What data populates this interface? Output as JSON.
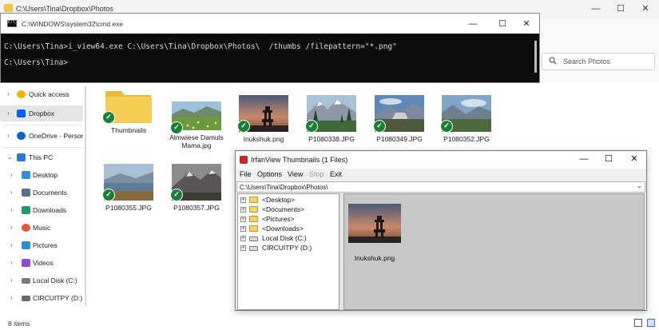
{
  "explorer": {
    "title": "C:\\Users\\Tina\\Dropbox\\Photos",
    "search_placeholder": "Search Photos",
    "status": "8 items",
    "sidebar": [
      {
        "label": "Quick access",
        "icon": "star-icon",
        "color": "#f5b400"
      },
      {
        "label": "Dropbox",
        "icon": "dropbox-icon",
        "color": "#0061fe"
      },
      {
        "label": "OneDrive - Person",
        "icon": "cloud-icon",
        "color": "#0a64c8"
      },
      {
        "label": "This PC",
        "icon": "pc-icon",
        "color": "#2b7bd3"
      },
      {
        "label": "Desktop",
        "icon": "desktop-icon",
        "color": "#2f8fe0"
      },
      {
        "label": "Documents",
        "icon": "documents-icon",
        "color": "#5b6f86"
      },
      {
        "label": "Downloads",
        "icon": "downloads-icon",
        "color": "#1a9b6b"
      },
      {
        "label": "Music",
        "icon": "music-icon",
        "color": "#e0583a"
      },
      {
        "label": "Pictures",
        "icon": "pictures-icon",
        "color": "#2a8dd6"
      },
      {
        "label": "Videos",
        "icon": "videos-icon",
        "color": "#8a4fd0"
      },
      {
        "label": "Local Disk (C:)",
        "icon": "drive-icon",
        "color": "#7a7a7a"
      },
      {
        "label": "CIRCUITPY (D:)",
        "icon": "usb-drive-icon",
        "color": "#6a6a6a"
      }
    ],
    "files": [
      {
        "name": "Thumbnails",
        "type": "folder"
      },
      {
        "name": "Almwiese Damuls Mama.jpg",
        "type": "image"
      },
      {
        "name": "Inukshuk.png",
        "type": "image"
      },
      {
        "name": "P1080338.JPG",
        "type": "image"
      },
      {
        "name": "P1080349.JPG",
        "type": "image"
      },
      {
        "name": "P1080352.JPG",
        "type": "image"
      },
      {
        "name": "P1080355.JPG",
        "type": "image"
      },
      {
        "name": "P1080357.JPG",
        "type": "image"
      }
    ]
  },
  "cmd": {
    "title": "C:\\WINDOWS\\system32\\cmd.exe",
    "icon_text": "C:\\",
    "line1": "C:\\Users\\Tina>i_view64.exe C:\\Users\\Tina\\Dropbox\\Photos\\  /thumbs /filepattern=\"*.png\"",
    "line2": "C:\\Users\\Tina>"
  },
  "irfanview": {
    "title": "IrfanView Thumbnails (1 Files)",
    "menu": [
      "File",
      "Options",
      "View",
      "Stop",
      "Exit"
    ],
    "path": "C:\\Users\\Tina\\Dropbox\\Photos\\",
    "tree": [
      "<Desktop>",
      "<Documents>",
      "<Pictures>",
      "<Downloads>",
      "Local Disk (C:)",
      "CIRCUITPY (D:)"
    ],
    "thumb_caption": "Inukshuk.png"
  },
  "window_buttons": {
    "minimize": "—",
    "maximize": "☐",
    "close": "✕"
  },
  "icons": {
    "check": "✓",
    "chevron_right": "›",
    "chevron_down": "⌄",
    "plus": "+",
    "dropdown": "⌄"
  }
}
